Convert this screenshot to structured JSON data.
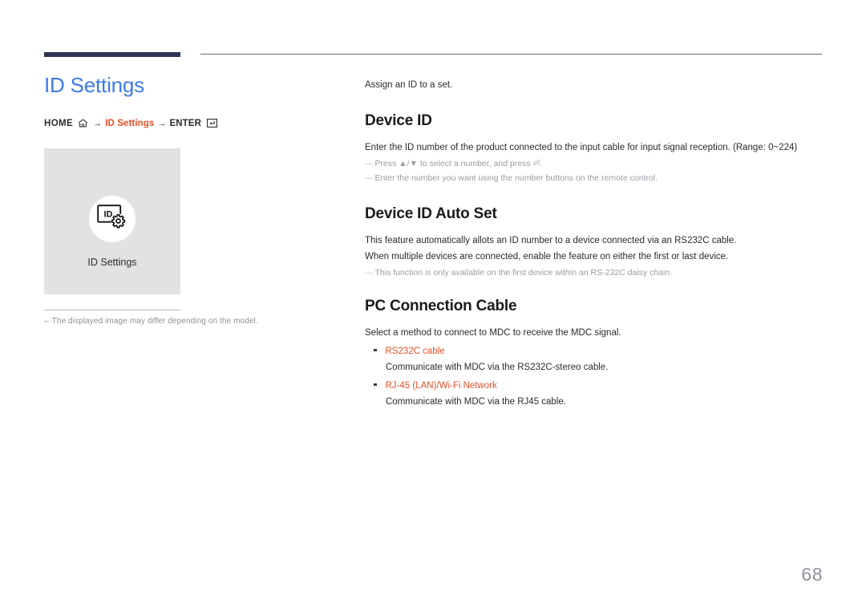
{
  "header": {
    "title": "ID Settings",
    "breadcrumb": {
      "home_label": "HOME",
      "home_icon": "home-icon",
      "arrow": "→",
      "current_label": "ID Settings",
      "enter_label": "ENTER",
      "enter_icon": "enter-key-icon"
    }
  },
  "figure": {
    "icon_label": "ID",
    "icon_name": "id-settings-icon",
    "caption": "ID Settings",
    "note_dash": "–",
    "note": "The displayed image may differ depending on the model."
  },
  "content": {
    "intro": "Assign an ID to a set.",
    "sections": [
      {
        "heading": "Device ID",
        "body": [
          "Enter the ID number of the product connected to the input cable for input signal reception. (Range: 0~224)"
        ],
        "notes": [
          "Press ▲/▼ to select a number, and press ⏎.",
          "Enter the number you want using the number buttons on the remote control."
        ]
      },
      {
        "heading": "Device ID Auto Set",
        "body": [
          "This feature automatically allots an ID number to a device connected via an RS232C cable.",
          "When multiple devices are connected, enable the feature on either the first or last device."
        ],
        "notes": [
          "This function is only available on the first device within an RS-232C daisy chain."
        ]
      },
      {
        "heading": "PC Connection Cable",
        "body": [
          "Select a method to connect to MDC to receive the MDC signal."
        ],
        "notes": [],
        "bullets": [
          {
            "term": "RS232C cable",
            "desc": "Communicate with MDC via the RS232C-stereo cable."
          },
          {
            "term": "RJ-45 (LAN)/Wi-Fi Network",
            "desc": "Communicate with MDC via the RJ45 cable."
          }
        ]
      }
    ]
  },
  "footer": {
    "page_number": "68"
  },
  "note_dash_glyph": "―",
  "colors": {
    "title_blue": "#3d7ae8",
    "accent_orange": "#e8502a",
    "rule_navy": "#2e3657",
    "figure_bg": "#e2e2e2",
    "note_gray": "#9a9ba4",
    "page_number_gray": "#8e8f99"
  }
}
